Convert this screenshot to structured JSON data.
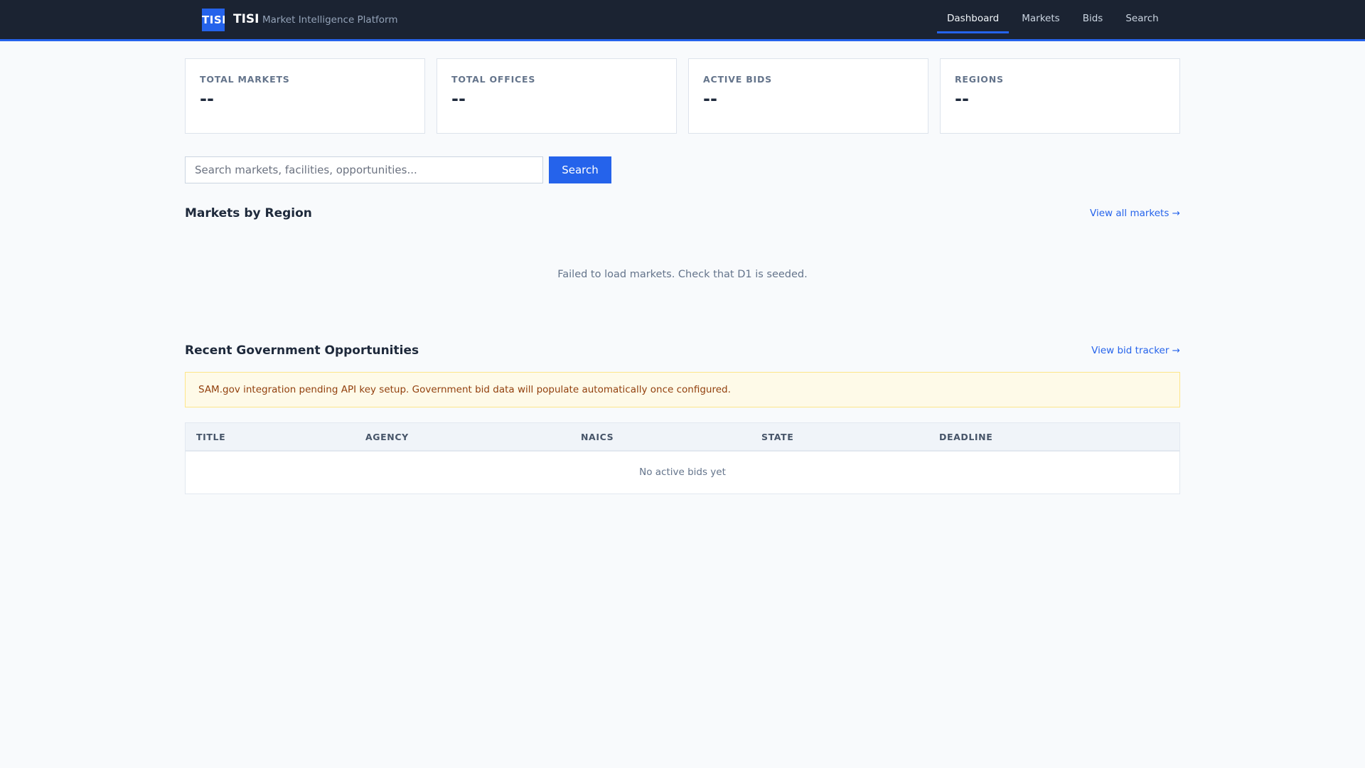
{
  "header": {
    "logo": "TISI",
    "brand": "TISI",
    "tagline": "Market Intelligence Platform",
    "nav": [
      {
        "label": "Dashboard",
        "active": true
      },
      {
        "label": "Markets"
      },
      {
        "label": "Bids"
      },
      {
        "label": "Search"
      }
    ]
  },
  "stats": [
    {
      "label": "TOTAL MARKETS",
      "value": "--"
    },
    {
      "label": "TOTAL OFFICES",
      "value": "--"
    },
    {
      "label": "ACTIVE BIDS",
      "value": "--"
    },
    {
      "label": "REGIONS",
      "value": "--"
    }
  ],
  "search": {
    "placeholder": "Search markets, facilities, opportunities...",
    "value": "",
    "button": "Search"
  },
  "markets": {
    "title": "Markets by Region",
    "link": "View all markets →",
    "error": "Failed to load markets. Check that D1 is seeded."
  },
  "opportunities": {
    "title": "Recent Government Opportunities",
    "link": "View bid tracker →",
    "alert": "SAM.gov integration pending API key setup. Government bid data will populate automatically once configured.",
    "columns": [
      "TITLE",
      "AGENCY",
      "NAICS",
      "STATE",
      "DEADLINE"
    ],
    "empty": "No active bids yet"
  }
}
